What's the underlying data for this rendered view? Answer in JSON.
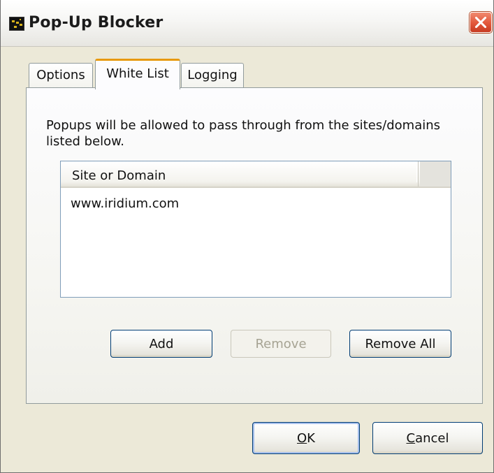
{
  "window": {
    "title": "Pop-Up Blocker"
  },
  "icons": {
    "app": "app-icon",
    "close": "close-icon"
  },
  "tabs": [
    {
      "label": "Options",
      "selected": false
    },
    {
      "label": "White List",
      "selected": true
    },
    {
      "label": "Logging",
      "selected": false
    }
  ],
  "whitelist": {
    "description": "Popups will be allowed to pass through from the sites/domains listed below.",
    "list": {
      "columns": [
        "Site or Domain"
      ],
      "rows": [
        "www.iridium.com"
      ]
    },
    "buttons": {
      "add": "Add",
      "remove": "Remove",
      "remove_all": "Remove All"
    }
  },
  "dialog_buttons": {
    "ok": "OK",
    "cancel": "Cancel"
  },
  "colors": {
    "close_button": "#e2563a",
    "active_tab_accent": "#e89a0e",
    "window_background": "#ece9d8"
  }
}
